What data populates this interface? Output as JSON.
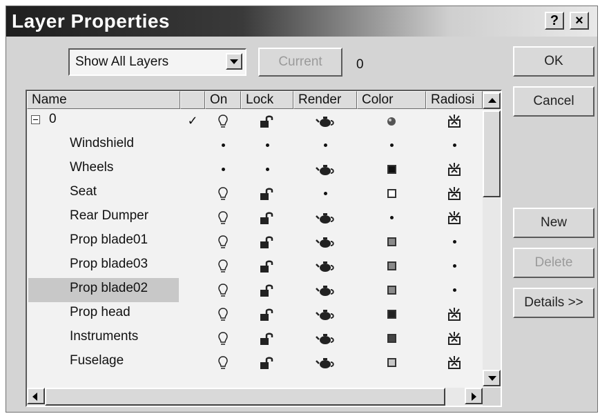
{
  "window": {
    "title": "Layer Properties"
  },
  "titlebar_buttons": {
    "help": "?",
    "close": "×"
  },
  "toolbar": {
    "filter_value": "Show All Layers",
    "current_label": "Current",
    "current_value": "0"
  },
  "buttons": {
    "ok": "OK",
    "cancel": "Cancel",
    "new": "New",
    "delete": "Delete",
    "details": "Details >>"
  },
  "columns": [
    {
      "label": "Name"
    },
    {
      "label": ""
    },
    {
      "label": "On"
    },
    {
      "label": "Lock"
    },
    {
      "label": "Render"
    },
    {
      "label": "Color"
    },
    {
      "label": "Radiosi"
    }
  ],
  "root_layer": {
    "name": "0",
    "current_mark": "✓",
    "on": "bulb",
    "lock": "unlocked",
    "render": "teapot",
    "color": "sphere",
    "radiosity": "radiosity"
  },
  "layers": [
    {
      "name": "Windshield",
      "on": "dot",
      "lock": "dot",
      "render": "dot",
      "color": "dot",
      "radiosity": "dot"
    },
    {
      "name": "Wheels",
      "on": "dot",
      "lock": "dot",
      "render": "teapot",
      "color": "#111111",
      "radiosity": "radiosity"
    },
    {
      "name": "Seat",
      "on": "bulb",
      "lock": "unlocked",
      "render": "dot",
      "color": "#ffffff",
      "radiosity": "radiosity"
    },
    {
      "name": "Rear Dumper",
      "on": "bulb",
      "lock": "unlocked",
      "render": "teapot",
      "color": "dot",
      "radiosity": "radiosity"
    },
    {
      "name": "Prop blade01",
      "on": "bulb",
      "lock": "unlocked",
      "render": "teapot",
      "color": "#8a8a8a",
      "radiosity": "dot"
    },
    {
      "name": "Prop blade03",
      "on": "bulb",
      "lock": "unlocked",
      "render": "teapot",
      "color": "#8a8a8a",
      "radiosity": "dot"
    },
    {
      "name": "Prop blade02",
      "on": "bulb",
      "lock": "unlocked",
      "render": "teapot",
      "color": "#8a8a8a",
      "radiosity": "dot",
      "selected": true
    },
    {
      "name": "Prop head",
      "on": "bulb",
      "lock": "unlocked",
      "render": "teapot",
      "color": "#222222",
      "radiosity": "radiosity"
    },
    {
      "name": "Instruments",
      "on": "bulb",
      "lock": "unlocked",
      "render": "teapot",
      "color": "#444444",
      "radiosity": "radiosity"
    },
    {
      "name": "Fuselage",
      "on": "bulb",
      "lock": "unlocked",
      "render": "teapot",
      "color": "#c8c8c8",
      "radiosity": "radiosity"
    }
  ]
}
